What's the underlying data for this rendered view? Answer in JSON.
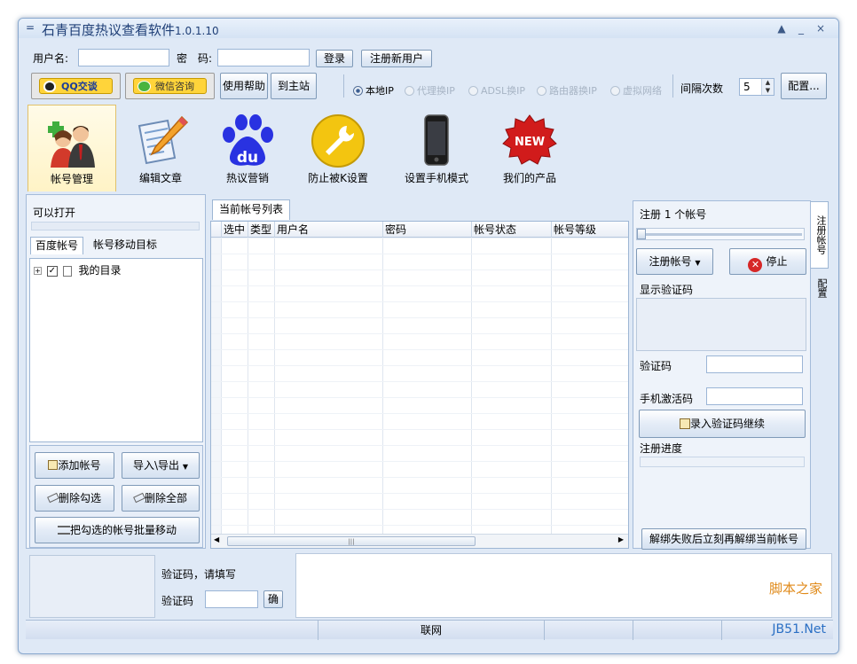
{
  "window": {
    "title": "石青百度热议查看软件",
    "version": "1.0.1.10",
    "controls": [
      "▲",
      "_",
      "×"
    ]
  },
  "login": {
    "username_label": "用户名:",
    "username_value": "",
    "password_label": "密　码:",
    "password_value": "",
    "login_button": "登录",
    "register_button": "注册新用户"
  },
  "toolbar": {
    "qq_button": "QQ交谈",
    "wechat_button": "微信咨询",
    "help_button": "使用帮助",
    "home_button": "到主站",
    "ip_options": [
      {
        "label": "本地IP",
        "selected": true
      },
      {
        "label": "代理换IP",
        "selected": false
      },
      {
        "label": "ADSL换IP",
        "selected": false
      },
      {
        "label": "路由器换IP",
        "selected": false
      },
      {
        "label": "虚拟网络",
        "selected": false
      }
    ],
    "interval_label": "间隔次数",
    "interval_value": "5",
    "config_button": "配置..."
  },
  "ribbon": [
    {
      "label": "帐号管理",
      "icon": "users-icon",
      "active": true
    },
    {
      "label": "编辑文章",
      "icon": "edit-document-icon",
      "active": false
    },
    {
      "label": "热议营销",
      "icon": "baidu-du-icon",
      "active": false
    },
    {
      "label": "防止被K设置",
      "icon": "wrench-icon",
      "active": false
    },
    {
      "label": "设置手机模式",
      "icon": "phone-icon",
      "active": false
    },
    {
      "label": "我们的产品",
      "icon": "new-badge-icon",
      "active": false
    }
  ],
  "left_panel": {
    "openable_label": "可以打开",
    "tabs": [
      "百度帐号",
      "帐号移动目标"
    ],
    "tree_root": "我的目录",
    "buttons": {
      "add_account": "添加帐号",
      "import_export": "导入\\导出",
      "delete_checked": "删除勾选",
      "delete_all": "删除全部",
      "batch_move": "把勾选的帐号批量移动"
    }
  },
  "account_list": {
    "tab": "当前帐号列表",
    "columns": [
      "选中",
      "类型",
      "用户名",
      "密码",
      "帐号状态",
      "帐号等级"
    ],
    "rows": []
  },
  "right_panel": {
    "register_count_label": "注册 1 个帐号",
    "slider_level": 0,
    "register_button": "注册帐号",
    "stop_button": "停止",
    "show_captcha_label": "显示验证码",
    "captcha_label": "验证码",
    "captcha_value": "",
    "sms_code_label": "手机激活码",
    "sms_code_value": "",
    "enter_captcha_button": "录入验证码继续",
    "progress_label": "注册进度",
    "progress": 0,
    "unbind_button": "解绑失败后立刻再解绑当前帐号",
    "side_tabs": [
      "注册帐号",
      "配置"
    ]
  },
  "bottom": {
    "captcha_prompt": "验证码，请填写",
    "captcha_label": "验证码",
    "captcha_value": "",
    "confirm_button": "确"
  },
  "statusbar": {
    "network": "联网"
  },
  "watermark": {
    "text1": "脚本之家",
    "text2": "JB51.Net"
  }
}
